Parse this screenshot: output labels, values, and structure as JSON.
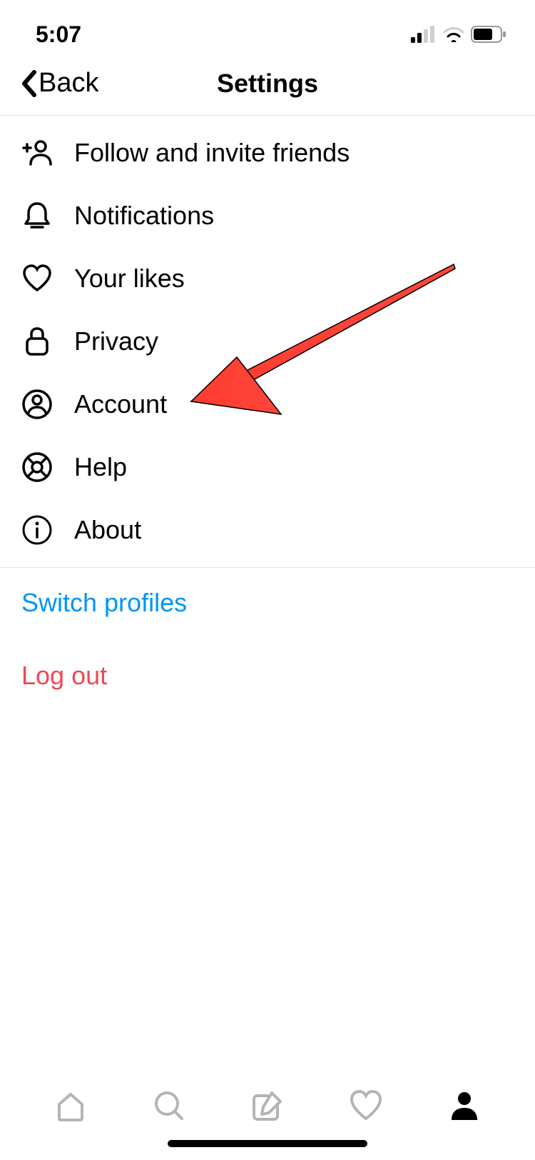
{
  "status": {
    "time": "5:07"
  },
  "header": {
    "back_label": "Back",
    "title": "Settings"
  },
  "settings": {
    "items": [
      {
        "icon": "add-person-icon",
        "label": "Follow and invite friends"
      },
      {
        "icon": "bell-icon",
        "label": "Notifications"
      },
      {
        "icon": "heart-icon",
        "label": "Your likes"
      },
      {
        "icon": "lock-icon",
        "label": "Privacy"
      },
      {
        "icon": "person-circle-icon",
        "label": "Account"
      },
      {
        "icon": "lifebuoy-icon",
        "label": "Help"
      },
      {
        "icon": "info-icon",
        "label": "About"
      }
    ]
  },
  "actions": {
    "switch_profiles": "Switch profiles",
    "log_out": "Log out"
  },
  "annotation": {
    "arrow_target": "Account"
  }
}
